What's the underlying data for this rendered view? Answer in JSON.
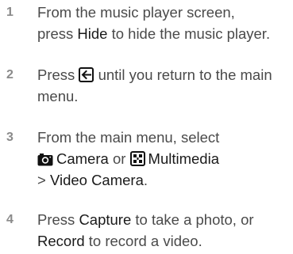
{
  "steps": [
    {
      "number": "1",
      "lines": [
        {
          "text": "From the music player screen,"
        },
        {
          "pre": "press ",
          "kw": "Hide",
          "post": " to hide the music player."
        }
      ]
    },
    {
      "number": "2",
      "lines": [
        {
          "pre": "Press ",
          "icon": "back-key-icon",
          "post": " until you return to the main"
        },
        {
          "text": "menu."
        }
      ]
    },
    {
      "number": "3",
      "lines": [
        {
          "text": "From the main menu, select"
        },
        {
          "icon1": "camera-icon",
          "kw1": "Camera",
          "mid": " or ",
          "icon2": "multimedia-icon",
          "kw2": "Multimedia"
        },
        {
          "pre": "> ",
          "kw": "Video Camera",
          "post": "."
        }
      ]
    },
    {
      "number": "4",
      "lines": [
        {
          "pre": "Press ",
          "kw": "Capture",
          "post": " to take a photo, or"
        },
        {
          "kw": "Record",
          "post": " to record a video."
        }
      ]
    }
  ],
  "colors": {
    "step_number": "#8a8a8a",
    "body_text": "#4a4a4a",
    "keyword_text": "#1a1a1a"
  }
}
